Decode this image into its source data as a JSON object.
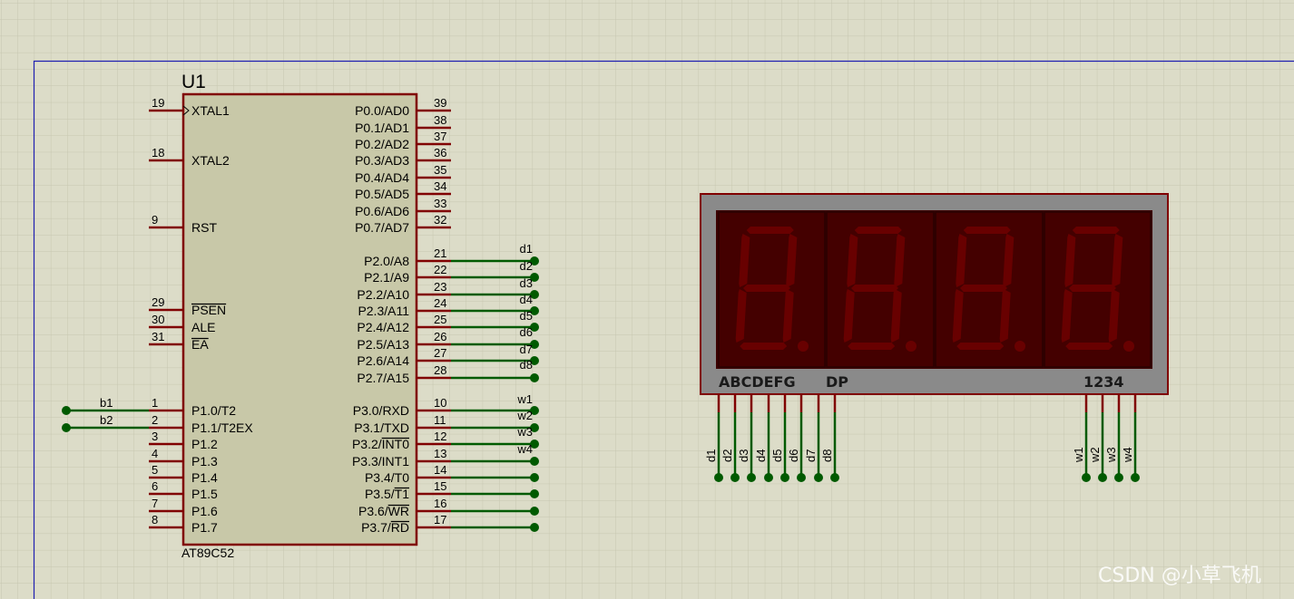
{
  "schematic": {
    "mcu": {
      "ref": "U1",
      "part": "AT89C52",
      "left_pins": [
        {
          "num": "19",
          "name": "XTAL1",
          "clock": true
        },
        {
          "num": "18",
          "name": "XTAL2"
        },
        {
          "num": "9",
          "name": "RST"
        },
        {
          "num": "29",
          "name": "PSEN",
          "overbar": "PSEN"
        },
        {
          "num": "30",
          "name": "ALE"
        },
        {
          "num": "31",
          "name": "EA",
          "overbar": "EA"
        },
        {
          "num": "1",
          "name": "P1.0/T2",
          "net": "b1"
        },
        {
          "num": "2",
          "name": "P1.1/T2EX",
          "net": "b2"
        },
        {
          "num": "3",
          "name": "P1.2"
        },
        {
          "num": "4",
          "name": "P1.3"
        },
        {
          "num": "5",
          "name": "P1.4"
        },
        {
          "num": "6",
          "name": "P1.5"
        },
        {
          "num": "7",
          "name": "P1.6"
        },
        {
          "num": "8",
          "name": "P1.7"
        }
      ],
      "right_pins": [
        {
          "num": "39",
          "name": "P0.0/AD0"
        },
        {
          "num": "38",
          "name": "P0.1/AD1"
        },
        {
          "num": "37",
          "name": "P0.2/AD2"
        },
        {
          "num": "36",
          "name": "P0.3/AD3"
        },
        {
          "num": "35",
          "name": "P0.4/AD4"
        },
        {
          "num": "34",
          "name": "P0.5/AD5"
        },
        {
          "num": "33",
          "name": "P0.6/AD6"
        },
        {
          "num": "32",
          "name": "P0.7/AD7"
        },
        {
          "num": "21",
          "name": "P2.0/A8",
          "net": "d1"
        },
        {
          "num": "22",
          "name": "P2.1/A9",
          "net": "d2"
        },
        {
          "num": "23",
          "name": "P2.2/A10",
          "net": "d3"
        },
        {
          "num": "24",
          "name": "P2.3/A11",
          "net": "d4"
        },
        {
          "num": "25",
          "name": "P2.4/A12",
          "net": "d5"
        },
        {
          "num": "26",
          "name": "P2.5/A13",
          "net": "d6"
        },
        {
          "num": "27",
          "name": "P2.6/A14",
          "net": "d7"
        },
        {
          "num": "28",
          "name": "P2.7/A15",
          "net": "d8"
        },
        {
          "num": "10",
          "name": "P3.0/RXD",
          "net": "w1"
        },
        {
          "num": "11",
          "name": "P3.1/TXD",
          "net": "w2"
        },
        {
          "num": "12",
          "name": "P3.2/INT0",
          "net": "w3",
          "overbar": "INT0"
        },
        {
          "num": "13",
          "name": "P3.3/INT1",
          "net": "w4"
        },
        {
          "num": "14",
          "name": "P3.4/T0",
          "wired": true
        },
        {
          "num": "15",
          "name": "P3.5/T1",
          "wired": true,
          "overbar": "T1"
        },
        {
          "num": "16",
          "name": "P3.6/WR",
          "wired": true,
          "overbar": "WR"
        },
        {
          "num": "17",
          "name": "P3.7/RD",
          "wired": true,
          "overbar": "RD"
        }
      ]
    },
    "display": {
      "digits": 4,
      "segment_label": "ABCDEFG",
      "dp_label": "DP",
      "digit_label": "1234",
      "segment_pins": [
        "d1",
        "d2",
        "d3",
        "d4",
        "d5",
        "d6",
        "d7",
        "d8"
      ],
      "digit_pins": [
        "w1",
        "w2",
        "w3",
        "w4"
      ]
    },
    "watermark": "CSDN @小草飞机",
    "colors": {
      "background": "#dcdcc8",
      "grid": "#c8c8b2",
      "sheet_border": "#2020b0",
      "chip_body": "#c8c8a8",
      "chip_outline": "#800000",
      "pin_line": "#800000",
      "wire": "#005a00",
      "display_frame": "#8a8a8a",
      "display_window": "#3c0000",
      "segment_off": "#680000"
    }
  }
}
